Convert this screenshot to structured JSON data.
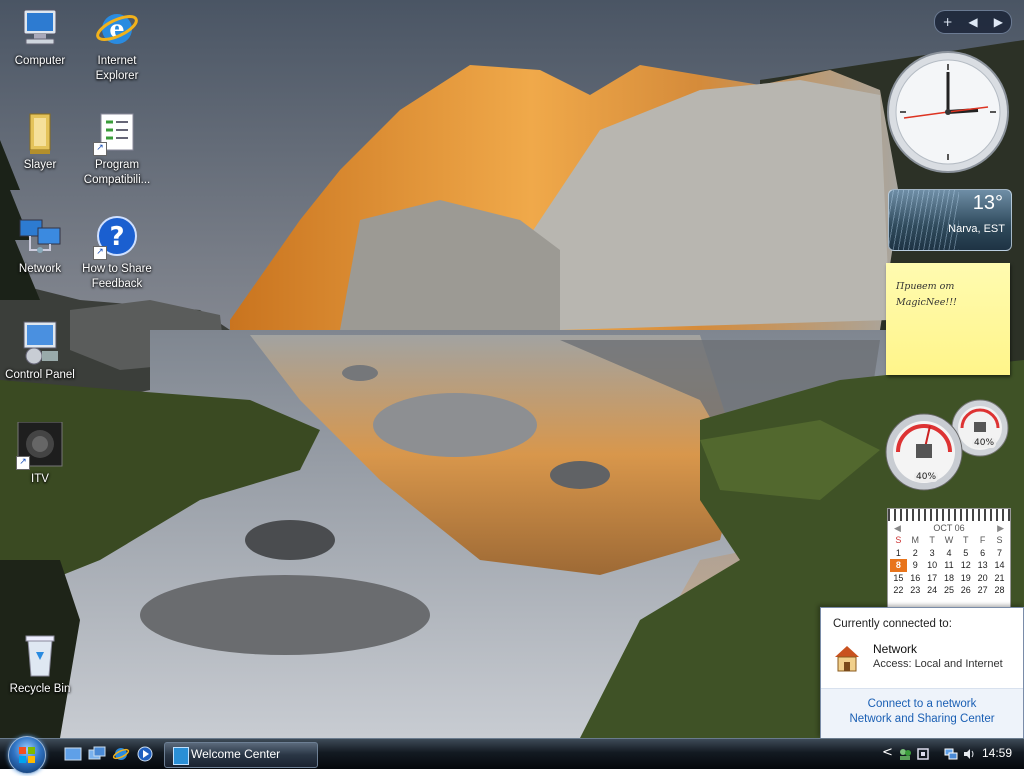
{
  "desktop": {
    "icons": [
      {
        "label": "Computer"
      },
      {
        "label": "Internet\nExplorer"
      },
      {
        "label": "Slayer"
      },
      {
        "label": "Program\nCompatibili..."
      },
      {
        "label": "Network"
      },
      {
        "label": "How to Share\nFeedback"
      },
      {
        "label": "Control Panel"
      },
      {
        "label": "ITV"
      },
      {
        "label": "Recycle Bin"
      }
    ]
  },
  "gadgets": {
    "toolbar": {
      "add": "+",
      "prev": "◀",
      "next": "▶"
    },
    "clock": {
      "time": "14:59"
    },
    "weather": {
      "temperature": "13°",
      "location": "Narva, EST"
    },
    "note": {
      "text": "Привет от MagicNee!!!"
    },
    "cpu_meter": {
      "cpu": "40%",
      "memory": "40%"
    },
    "calendar": {
      "month": "OCT 06",
      "weekdays": [
        "S",
        "M",
        "T",
        "W",
        "T",
        "F",
        "S"
      ],
      "weeks": [
        [
          "1",
          "2",
          "3",
          "4",
          "5",
          "6",
          "7"
        ],
        [
          "8",
          "9",
          "10",
          "11",
          "12",
          "13",
          "14"
        ],
        [
          "15",
          "16",
          "17",
          "18",
          "19",
          "20",
          "21"
        ],
        [
          "22",
          "23",
          "24",
          "25",
          "26",
          "27",
          "28"
        ]
      ],
      "today": "8"
    }
  },
  "network_flyout": {
    "title": "Currently connected to:",
    "network_name": "Network",
    "access": "Access:  Local and Internet",
    "link_connect": "Connect to a network",
    "link_center": "Network and Sharing Center"
  },
  "taskbar": {
    "windows": [
      {
        "label": "Welcome Center"
      }
    ],
    "clock": "14:59",
    "tray_expand": "<"
  },
  "colors": {
    "accent": "#e8741b",
    "link": "#1a5fb4"
  }
}
